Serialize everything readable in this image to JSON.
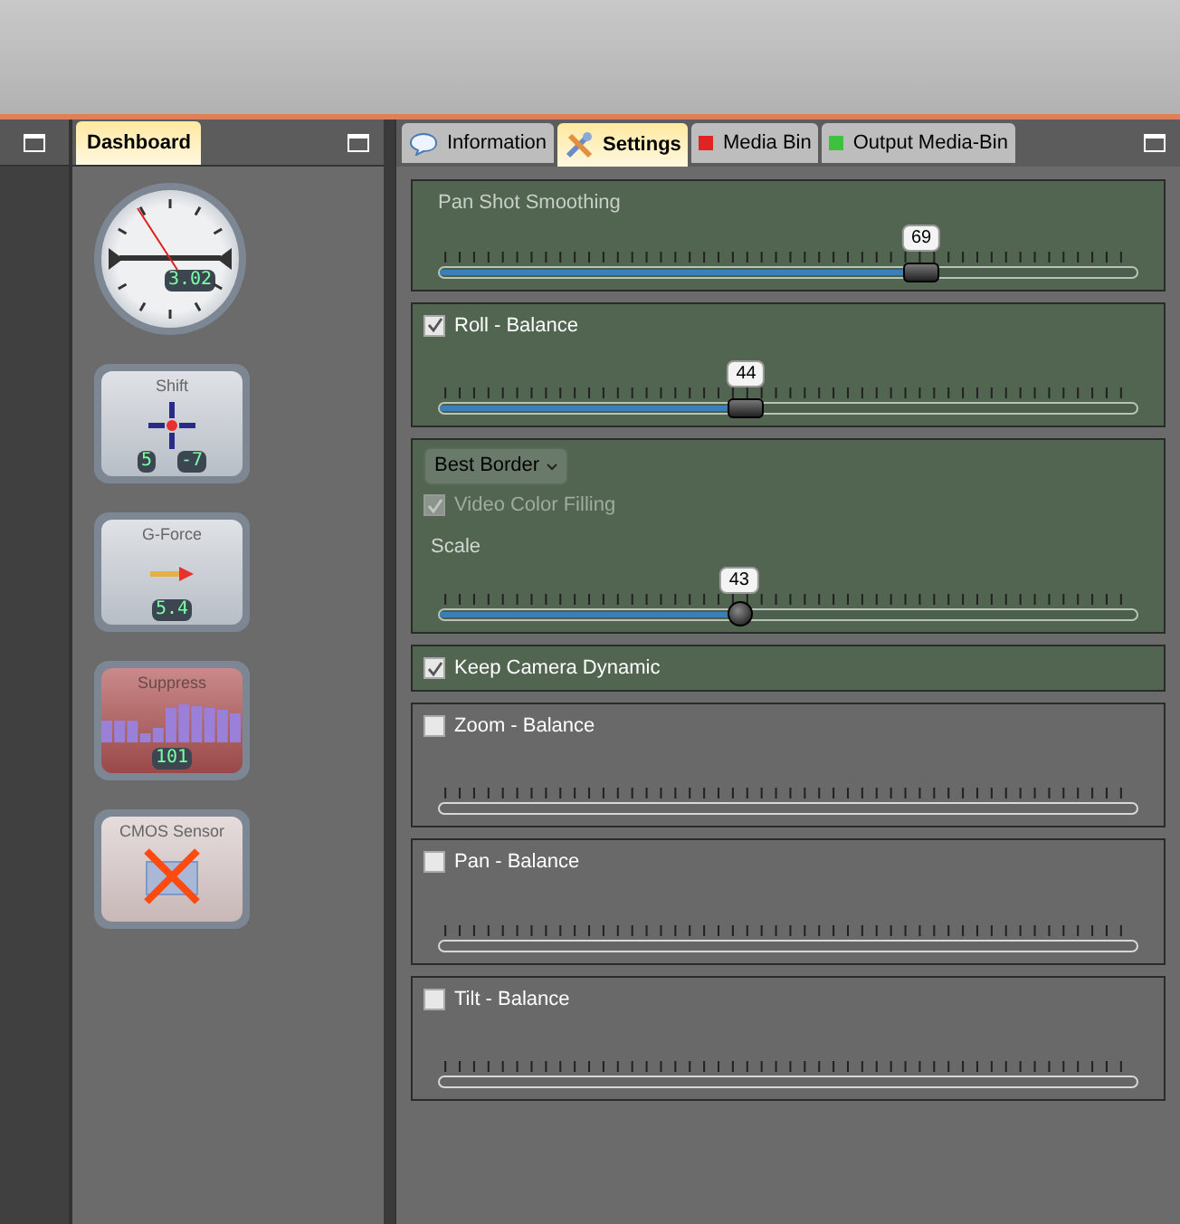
{
  "left_panel": {
    "tab": {
      "label": "Dashboard",
      "selected": true
    }
  },
  "widgets": [
    {
      "kind": "clock",
      "reading": "3.02"
    },
    {
      "kind": "crosshair",
      "title": "Shift",
      "readings": [
        "5",
        "-7"
      ]
    },
    {
      "kind": "gforce",
      "title": "G-Force",
      "readings": [
        "5.4"
      ]
    },
    {
      "kind": "bars",
      "title": "Suppress",
      "readings": [
        "101"
      ]
    },
    {
      "kind": "sensor",
      "title": "CMOS Sensor"
    }
  ],
  "tabs": [
    {
      "label": "Information",
      "selected": false
    },
    {
      "label": "Settings",
      "selected": true
    },
    {
      "label": "Media Bin",
      "color": "#e02424",
      "selected": false
    },
    {
      "label": "Output Media-Bin",
      "color": "#3cc23c",
      "selected": false
    }
  ],
  "panels": [
    {
      "title": "Pan Shot Smoothing",
      "active": true,
      "slider": {
        "enabled": true,
        "value": "69",
        "level": 0.69
      }
    },
    {
      "checkbox": {
        "label": "Roll - Balance",
        "checked": true,
        "disabled": false
      },
      "active": true,
      "slider": {
        "enabled": true,
        "value": "44",
        "level": 0.44
      }
    },
    {
      "dropdown": {
        "value": "Best Border"
      },
      "checkbox": {
        "label": "Video Color Filling",
        "checked": true,
        "disabled": true
      },
      "slider_label": "Scale",
      "active": true,
      "slider": {
        "enabled": true,
        "value": "43",
        "level": 0.43
      }
    },
    {
      "checkbox": {
        "label": "Keep Camera Dynamic",
        "checked": true,
        "disabled": false
      },
      "active": true
    },
    {
      "checkbox": {
        "label": "Zoom - Balance",
        "checked": false,
        "disabled": false
      },
      "active": false,
      "slider": {
        "enabled": false
      }
    },
    {
      "checkbox": {
        "label": "Pan - Balance",
        "checked": false,
        "disabled": false
      },
      "active": false,
      "slider": {
        "enabled": false
      }
    },
    {
      "checkbox": {
        "label": "Tilt - Balance",
        "checked": false,
        "disabled": false
      },
      "active": false,
      "slider": {
        "enabled": false
      }
    }
  ]
}
